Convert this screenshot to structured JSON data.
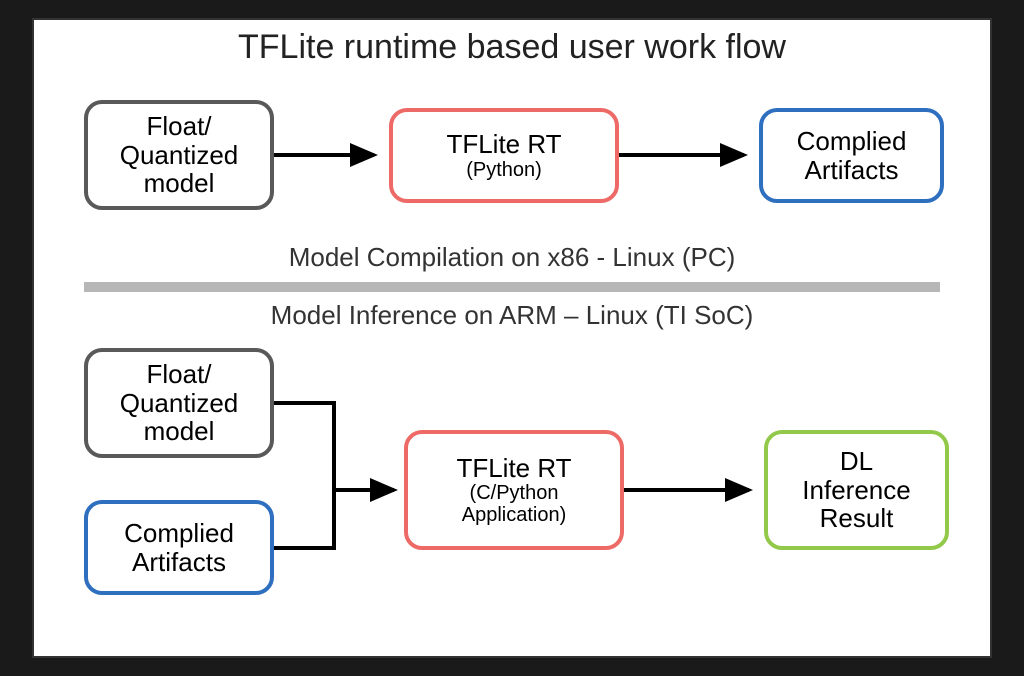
{
  "title": "TFLite runtime based user work flow",
  "section_top": {
    "caption": "Model Compilation on x86 - Linux (PC)",
    "nodes": {
      "model": {
        "line1": "Float/",
        "line2": "Quantized",
        "line3": "model"
      },
      "runtime": {
        "line1": "TFLite RT",
        "sub": "(Python)"
      },
      "artifacts": {
        "line1": "Complied",
        "line2": "Artifacts"
      }
    }
  },
  "section_bottom": {
    "caption": "Model Inference on ARM – Linux (TI SoC)",
    "nodes": {
      "model": {
        "line1": "Float/",
        "line2": "Quantized",
        "line3": "model"
      },
      "artifacts": {
        "line1": "Complied",
        "line2": "Artifacts"
      },
      "runtime": {
        "line1": "TFLite RT",
        "sub1": "(C/Python",
        "sub2": "Application)"
      },
      "result": {
        "line1": "DL",
        "line2": "Inference",
        "line3": "Result"
      }
    }
  },
  "colors": {
    "dark": "#595959",
    "red": "#ed6a66",
    "blue": "#2f6fbf",
    "green": "#93c94a",
    "divider": "#b7b7b7"
  }
}
